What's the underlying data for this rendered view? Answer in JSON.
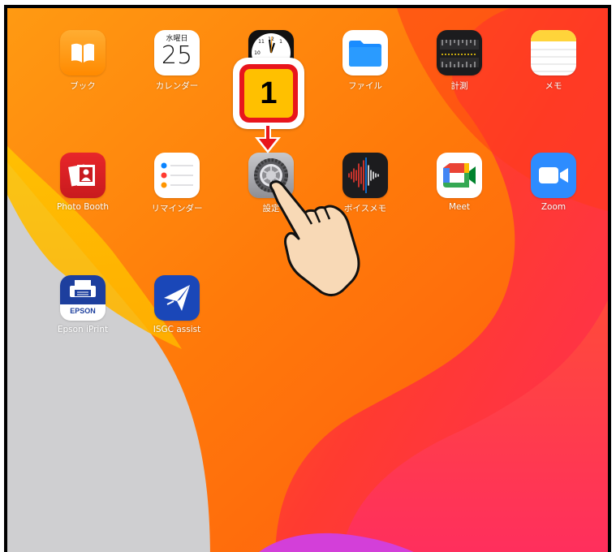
{
  "home_screen": {
    "row1": [
      {
        "label": "ブック",
        "icon": "book-icon"
      },
      {
        "label": "カレンダー",
        "icon": "calendar-icon",
        "day": "水曜日",
        "date": "25"
      },
      {
        "label": "",
        "icon": "clock-icon"
      },
      {
        "label": "ファイル",
        "icon": "folder-icon"
      },
      {
        "label": "計測",
        "icon": "ruler-icon"
      },
      {
        "label": "メモ",
        "icon": "notes-icon"
      }
    ],
    "row2": [
      {
        "label": "Photo Booth",
        "icon": "photo-booth-icon"
      },
      {
        "label": "リマインダー",
        "icon": "reminders-icon"
      },
      {
        "label": "設定",
        "icon": "settings-gear-icon"
      },
      {
        "label": "ボイスメモ",
        "icon": "voice-memo-icon"
      },
      {
        "label": "Meet",
        "icon": "meet-icon"
      },
      {
        "label": "Zoom",
        "icon": "zoom-icon"
      }
    ],
    "row3": [
      {
        "label": "Epson iPrint",
        "icon": "epson-printer-icon",
        "brand": "EPSON"
      },
      {
        "label": "ISGC assist",
        "icon": "isgc-plane-icon"
      }
    ]
  },
  "annotation": {
    "step_number": "1",
    "colors": {
      "badge_fill": "#ffc000",
      "badge_border": "#e8151c",
      "arrow": "#e8151c"
    }
  }
}
